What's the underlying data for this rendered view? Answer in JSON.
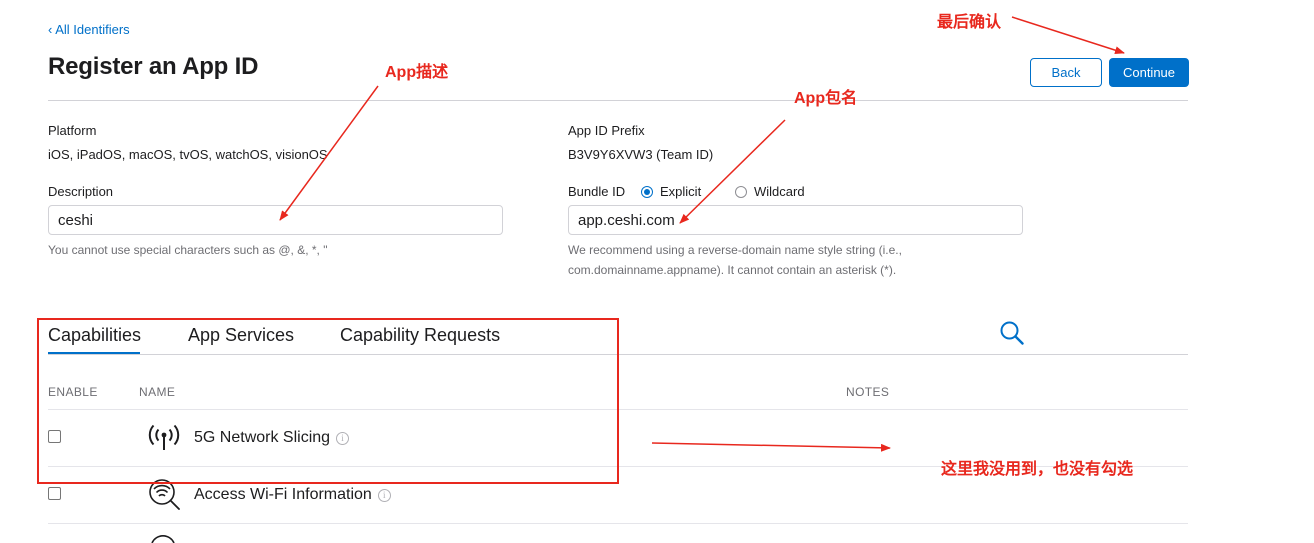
{
  "breadcrumb": {
    "label": "‹ All Identifiers"
  },
  "header": {
    "title": "Register an App ID",
    "back_label": "Back",
    "continue_label": "Continue"
  },
  "form": {
    "platform": {
      "label": "Platform",
      "value": "iOS, iPadOS, macOS, tvOS, watchOS, visionOS"
    },
    "prefix": {
      "label": "App ID Prefix",
      "value": "B3V9Y6XVW3 (Team ID)"
    },
    "description": {
      "label": "Description",
      "value": "ceshi",
      "help": "You cannot use special characters such as @, &, *, \""
    },
    "bundle_id": {
      "label": "Bundle ID",
      "options": [
        {
          "label": "Explicit",
          "selected": true
        },
        {
          "label": "Wildcard",
          "selected": false
        }
      ],
      "value": "app.ceshi.com",
      "help_line1": "We recommend using a reverse-domain name style string (i.e.,",
      "help_line2": "com.domainname.appname). It cannot contain an asterisk (*)."
    }
  },
  "tabs": [
    {
      "label": "Capabilities",
      "active": true
    },
    {
      "label": "App Services",
      "active": false
    },
    {
      "label": "Capability Requests",
      "active": false
    }
  ],
  "table": {
    "headers": {
      "enable": "ENABLE",
      "name": "NAME",
      "notes": "NOTES"
    },
    "rows": [
      {
        "name": "5G Network Slicing",
        "icon": "antenna-icon",
        "enabled": false
      },
      {
        "name": "Access Wi-Fi Information",
        "icon": "wifi-search-icon",
        "enabled": false
      }
    ]
  },
  "annotations": {
    "confirm": "最后确认",
    "description": "App描述",
    "bundle": "App包名",
    "unused": "这里我没用到，也没有勾选"
  },
  "colors": {
    "accent": "#0070c9",
    "annotation": "#e8281e"
  },
  "icons": {
    "search": "search-icon",
    "info": "info-icon"
  }
}
